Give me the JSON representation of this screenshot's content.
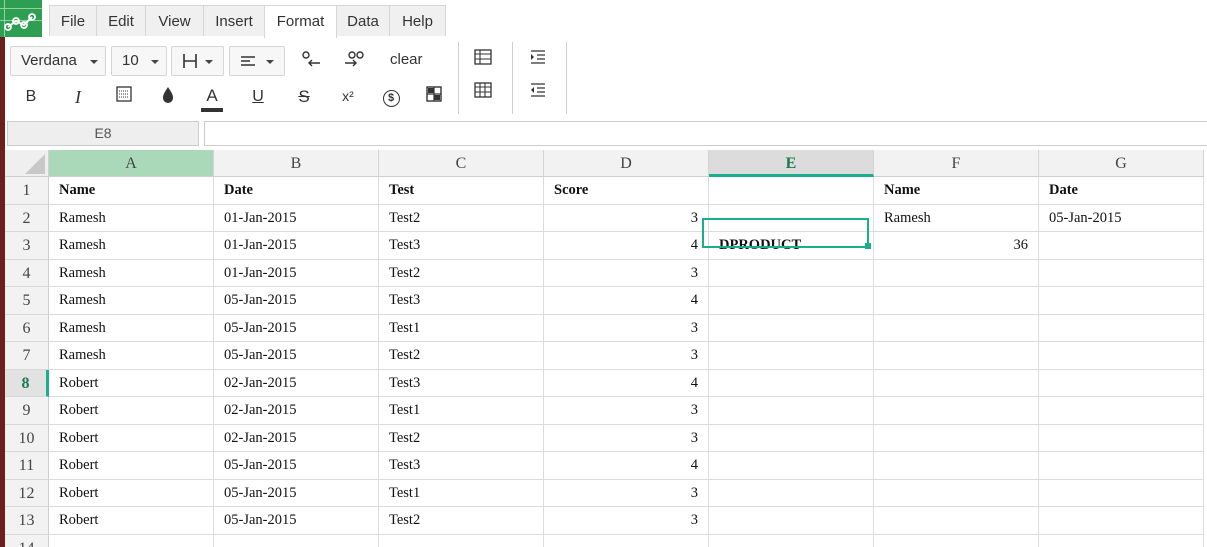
{
  "menu": {
    "items": [
      "File",
      "Edit",
      "View",
      "Insert",
      "Format",
      "Data",
      "Help"
    ],
    "active": "Format"
  },
  "toolbar": {
    "font_family": "Verdana",
    "font_size": "10",
    "clear_label": "clear",
    "icons": {
      "bold": "B",
      "italic": "I",
      "superscript": "x²",
      "underline": "U",
      "strike": "S",
      "text_color": "A",
      "currency": "$"
    }
  },
  "namebox": {
    "value": "E8"
  },
  "formula": {
    "value": ""
  },
  "columns": [
    "A",
    "B",
    "C",
    "D",
    "E",
    "F",
    "G"
  ],
  "rows": [
    "1",
    "2",
    "3",
    "4",
    "5",
    "6",
    "7",
    "8",
    "9",
    "10",
    "11",
    "12",
    "13",
    "14"
  ],
  "active_cell": "E8",
  "cells": {
    "A": [
      "Name",
      "Ramesh",
      "Ramesh",
      "Ramesh",
      "Ramesh",
      "Ramesh",
      "Ramesh",
      "Robert",
      "Robert",
      "Robert",
      "Robert",
      "Robert",
      "Robert",
      ""
    ],
    "B": [
      "Date",
      "01-Jan-2015",
      "01-Jan-2015",
      "01-Jan-2015",
      "05-Jan-2015",
      "05-Jan-2015",
      "05-Jan-2015",
      "02-Jan-2015",
      "02-Jan-2015",
      "02-Jan-2015",
      "05-Jan-2015",
      "05-Jan-2015",
      "05-Jan-2015",
      ""
    ],
    "C": [
      "Test",
      "Test2",
      "Test3",
      "Test2",
      "Test3",
      "Test1",
      "Test2",
      "Test3",
      "Test1",
      "Test2",
      "Test3",
      "Test1",
      "Test2",
      ""
    ],
    "D": [
      "Score",
      "3",
      "4",
      "3",
      "4",
      "3",
      "3",
      "4",
      "3",
      "3",
      "4",
      "3",
      "3",
      ""
    ],
    "E": [
      "",
      "",
      "DPRODUCT",
      "",
      "",
      "",
      "",
      "",
      "",
      "",
      "",
      "",
      "",
      ""
    ],
    "F": [
      "Name",
      "Ramesh",
      "36",
      "",
      "",
      "",
      "",
      "",
      "",
      "",
      "",
      "",
      "",
      ""
    ],
    "G": [
      "Date",
      "05-Jan-2015",
      "",
      "",
      "",
      "",
      "",
      "",
      "",
      "",
      "",
      "",
      "",
      ""
    ]
  },
  "colors": {
    "accent": "#1aaf8c",
    "logo": "#2e9e52",
    "selected_col": "#a9d9b8"
  }
}
